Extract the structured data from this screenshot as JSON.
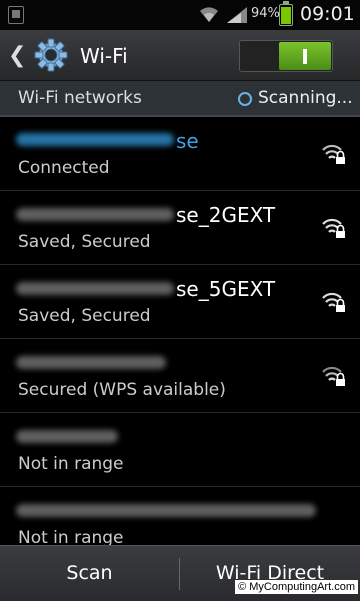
{
  "status_bar": {
    "battery_percent": "94%",
    "battery_level": 0.94,
    "time": "09:01",
    "icons": [
      "notification-icon",
      "wifi-icon",
      "signal-icon",
      "battery-icon"
    ]
  },
  "action_bar": {
    "title": "Wi-Fi",
    "back_icon": "back-chevron-icon",
    "app_icon": "gear-icon",
    "toggle_label": "I",
    "toggle_on": true
  },
  "section": {
    "title": "Wi-Fi networks",
    "status": "Scanning..."
  },
  "networks": [
    {
      "visible_name": "se",
      "status": "Connected",
      "connected": true,
      "secured": true,
      "signal": "wifi-lock-icon"
    },
    {
      "visible_name": "se_2GEXT",
      "status": "Saved, Secured",
      "connected": false,
      "secured": true,
      "signal": "wifi-lock-icon"
    },
    {
      "visible_name": "se_5GEXT",
      "status": "Saved, Secured",
      "connected": false,
      "secured": true,
      "signal": "wifi-lock-icon"
    },
    {
      "visible_name": "",
      "status": "Secured (WPS available)",
      "connected": false,
      "secured": true,
      "signal": "wifi-lock-icon"
    },
    {
      "visible_name": "",
      "status": "Not in range",
      "connected": false,
      "secured": false,
      "signal": ""
    },
    {
      "visible_name": "",
      "status": "Not in range",
      "connected": false,
      "secured": false,
      "signal": ""
    }
  ],
  "bottom_bar": {
    "scan_label": "Scan",
    "wifi_direct_label": "Wi-Fi Direct"
  },
  "watermark": "© MyComputingArt.com",
  "colors": {
    "accent_blue": "#3ea0e6",
    "toggle_green": "#5aa81e",
    "background": "#000000"
  }
}
